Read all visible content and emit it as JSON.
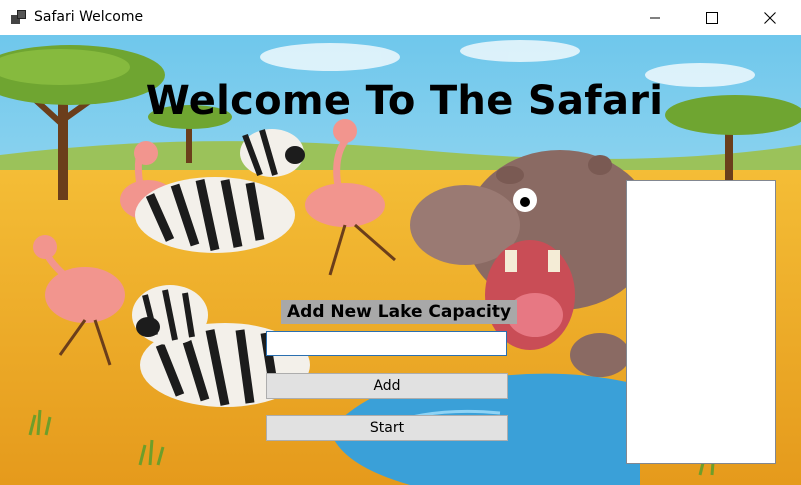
{
  "window": {
    "title": "Safari Welcome",
    "icons": {
      "app": "app-icon",
      "minimize": "minimize-icon",
      "maximize": "maximize-icon",
      "close": "close-icon"
    }
  },
  "main": {
    "heading": "Welcome To The Safari",
    "capacity_label": "Add New Lake Capacity",
    "capacity_input": {
      "value": "",
      "placeholder": ""
    },
    "add_label": "Add",
    "start_label": "Start",
    "lake_list": {
      "items": []
    }
  },
  "colors": {
    "sky": "#8fd3ee",
    "savanna": "#f0b52a",
    "water": "#3aa0d8",
    "button_face": "#e1e1e1",
    "label_background": "#a8a8a8"
  }
}
